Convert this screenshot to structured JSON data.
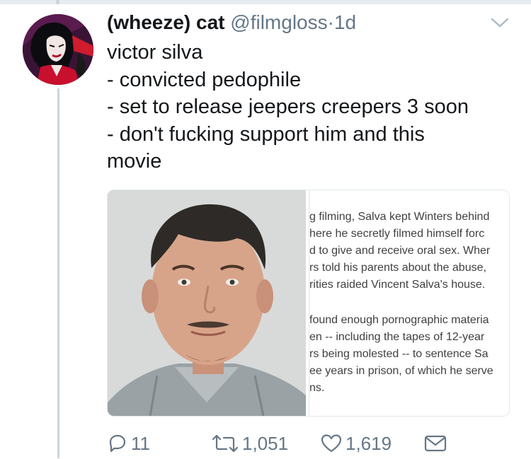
{
  "tweet": {
    "display_name": "(wheeze) cat",
    "handle": "@filmgloss",
    "separator": "·",
    "time": "1d",
    "lines": [
      "victor silva",
      "- convicted pedophile",
      "- set to release jeepers creepers 3 soon",
      "- don't fucking support him and this",
      "movie"
    ]
  },
  "card": {
    "article_paragraphs": [
      [
        "g filming, Salva kept Winters behind",
        "here he secretly filmed himself forc",
        "d to give and receive oral sex. Wher",
        "rs told his parents about the abuse,",
        "rities raided Vincent Salva's house."
      ],
      [
        "found enough pornographic materia",
        "en -- including the tapes of 12-year",
        "rs being molested -- to sentence Sa",
        "ee years in prison, of which he serve",
        "ns."
      ]
    ]
  },
  "actions": {
    "reply_count": "11",
    "retweet_count": "1,051",
    "like_count": "1,619"
  },
  "colors": {
    "text": "#14171a",
    "secondary": "#657786",
    "thread_line": "#ccd6dd",
    "card_border": "#e1e8ed"
  },
  "icons": {
    "caret": "chevron-down-icon",
    "reply": "reply-icon",
    "retweet": "retweet-icon",
    "like": "heart-icon",
    "message": "envelope-icon"
  }
}
